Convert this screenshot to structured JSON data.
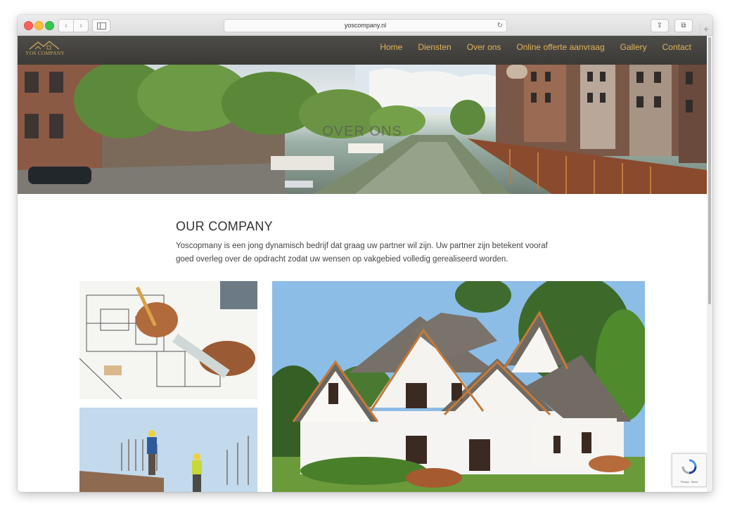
{
  "browser": {
    "url": "yoscompany.nl",
    "back_glyph": "‹",
    "forward_glyph": "›",
    "reload_glyph": "↻",
    "share_glyph": "⇪",
    "tabs_glyph": "⧉",
    "new_tab_glyph": "+"
  },
  "site": {
    "logo_text": "YOS COMPANY",
    "nav": [
      "Home",
      "Diensten",
      "Over ons",
      "Online offerte aanvraag",
      "Gallery",
      "Contact"
    ],
    "hero_title": "OVER ONS",
    "section_title": "OUR COMPANY",
    "section_text": "Yoscopmany is een jong dynamisch bedrijf dat graag uw partner wil zijn. Uw partner zijn betekent vooraf goed overleg over de opdracht zodat uw wensen op vakgebied volledig gerealiseerd worden.",
    "recaptcha_text": "Privacy - Terms",
    "colors": {
      "nav_bg": "#45433f",
      "nav_link": "#e2b45a",
      "logo": "#c8a65c"
    }
  }
}
